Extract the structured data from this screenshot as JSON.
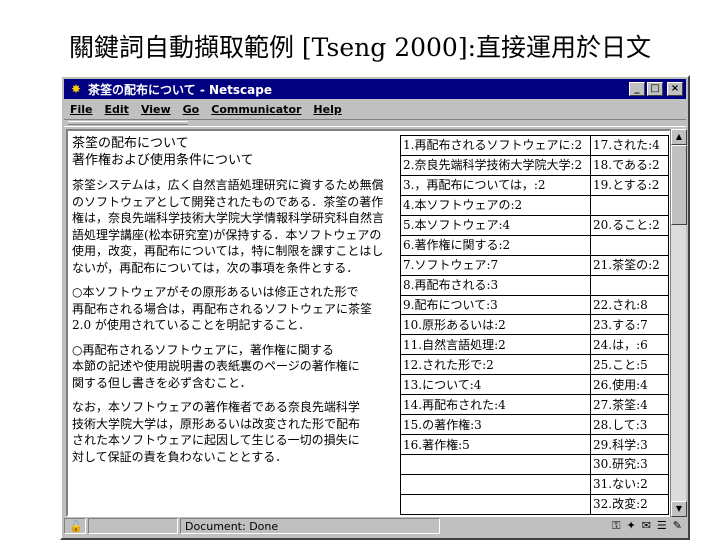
{
  "slide": {
    "title": "關鍵詞自動擷取範例 [Tseng 2000]:直接運用於日文"
  },
  "window": {
    "title": "茶筌の配布について - Netscape",
    "buttons": {
      "minimize": "_",
      "maximize": "□",
      "close": "×"
    }
  },
  "menu": {
    "items": [
      "File",
      "Edit",
      "View",
      "Go",
      "Communicator",
      "Help"
    ]
  },
  "document": {
    "headings": [
      "茶筌の配布について",
      "著作権および使用条件について"
    ],
    "paragraphs": [
      [
        "茶筌システムは，広く自然言語処理研究に資するため無償",
        "のソフトウェアとして開発されたものである．茶筌の著作",
        "権は，奈良先端科学技術大学院大学情報科学研究科自然言",
        "語処理学講座(松本研究室)が保持する．本ソフトウェアの",
        "使用，改変，再配布については，特に制限を課すことはし",
        "ないが，再配布については，次の事項を条件とする．"
      ],
      [
        "○本ソフトウェアがその原形あるいは修正された形で",
        "再配布される場合は，再配布されるソフトウェアに茶筌",
        "2.0 が使用されていることを明記すること．"
      ],
      [
        "○再配布されるソフトウェアに，著作権に関する",
        "本節の記述や使用説明書の表紙裏のページの著作権に",
        "関する但し書きを必ず含むこと．"
      ],
      [
        "なお，本ソフトウェアの著作権者である奈良先端科学",
        "技術大学院大学は，原形あるいは改変された形で配布",
        "された本ソフトウェアに起因して生じる一切の損失に",
        "対して保証の責を負わないこととする．"
      ]
    ]
  },
  "results": {
    "rows": [
      [
        "1.再配布されるソフトウェアに:2",
        "17.された:4"
      ],
      [
        "2.奈良先端科学技術大学院大学:2",
        "18.である:2"
      ],
      [
        "3.，再配布については，:2",
        "19.とする:2"
      ],
      [
        "4.本ソフトウェアの:2",
        ""
      ],
      [
        "5.本ソフトウェア:4",
        "20.ること:2"
      ],
      [
        "6.著作権に関する:2",
        ""
      ],
      [
        "7.ソフトウェア:7",
        "21.茶筌の:2"
      ],
      [
        "8.再配布される:3",
        ""
      ],
      [
        "9.配布について:3",
        "22.され:8"
      ],
      [
        "10.原形あるいは:2",
        "23.する:7"
      ],
      [
        "11.自然言語処理:2",
        "24.は，:6"
      ],
      [
        "12.された形で:2",
        "25.こと:5"
      ],
      [
        "13.について:4",
        "26.使用:4"
      ],
      [
        "14.再配布された:4",
        "27.茶筌:4"
      ],
      [
        "15.の著作権:3",
        "28.して:3"
      ],
      [
        "16.著作権:5",
        "29.科学:3"
      ],
      [
        "",
        "30.研究:3"
      ],
      [
        "",
        "31.ない:2"
      ],
      [
        "",
        "32.改変:2"
      ]
    ]
  },
  "status": {
    "text": "Document: Done",
    "icons": [
      "security-icon",
      "component-icon",
      "mail-icon",
      "discussion-icon",
      "composer-icon"
    ]
  }
}
